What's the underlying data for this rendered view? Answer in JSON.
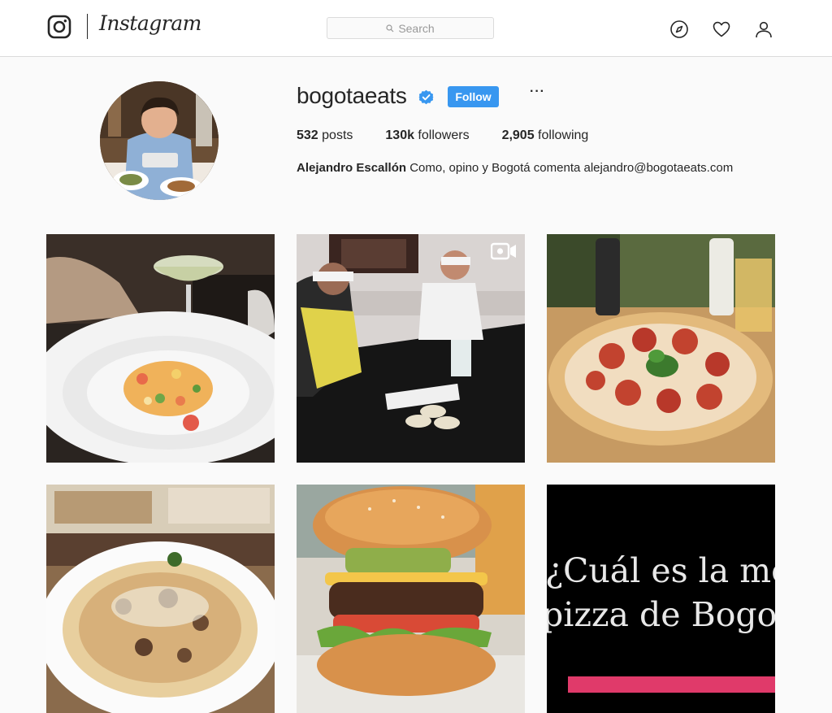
{
  "nav": {
    "wordmark": "Instagram",
    "search_placeholder": "Search",
    "icons": [
      "instagram-glyph-icon",
      "compass-icon",
      "heart-icon",
      "user-icon"
    ]
  },
  "profile": {
    "username": "bogotaeats",
    "verified": true,
    "follow_label": "Follow",
    "more_label": "···",
    "stats": {
      "posts_count": "532",
      "posts_label": " posts",
      "followers_count": "130k",
      "followers_label": " followers",
      "following_count": "2,905",
      "following_label": " following"
    },
    "bio_name": "Alejandro Escallón",
    "bio_text": " Como, opino y Bogotá comenta alejandro@bogotaeats.com"
  },
  "posts": [
    {
      "subject": "ceviche dish with cocktail"
    },
    {
      "subject": "blindfolded wine tasting",
      "is_video": true
    },
    {
      "subject": "pepperoni pizza"
    },
    {
      "subject": "pasta with mushrooms and cheese"
    },
    {
      "subject": "cheeseburger with avocado"
    },
    {
      "subject": "text card",
      "line1": "¿Cuál es la mejo",
      "line2": "pizza de Bogotá"
    }
  ],
  "colors": {
    "accent": "#3897f0",
    "background": "#fafafa",
    "text": "#262626",
    "border": "#dbdbdb"
  }
}
